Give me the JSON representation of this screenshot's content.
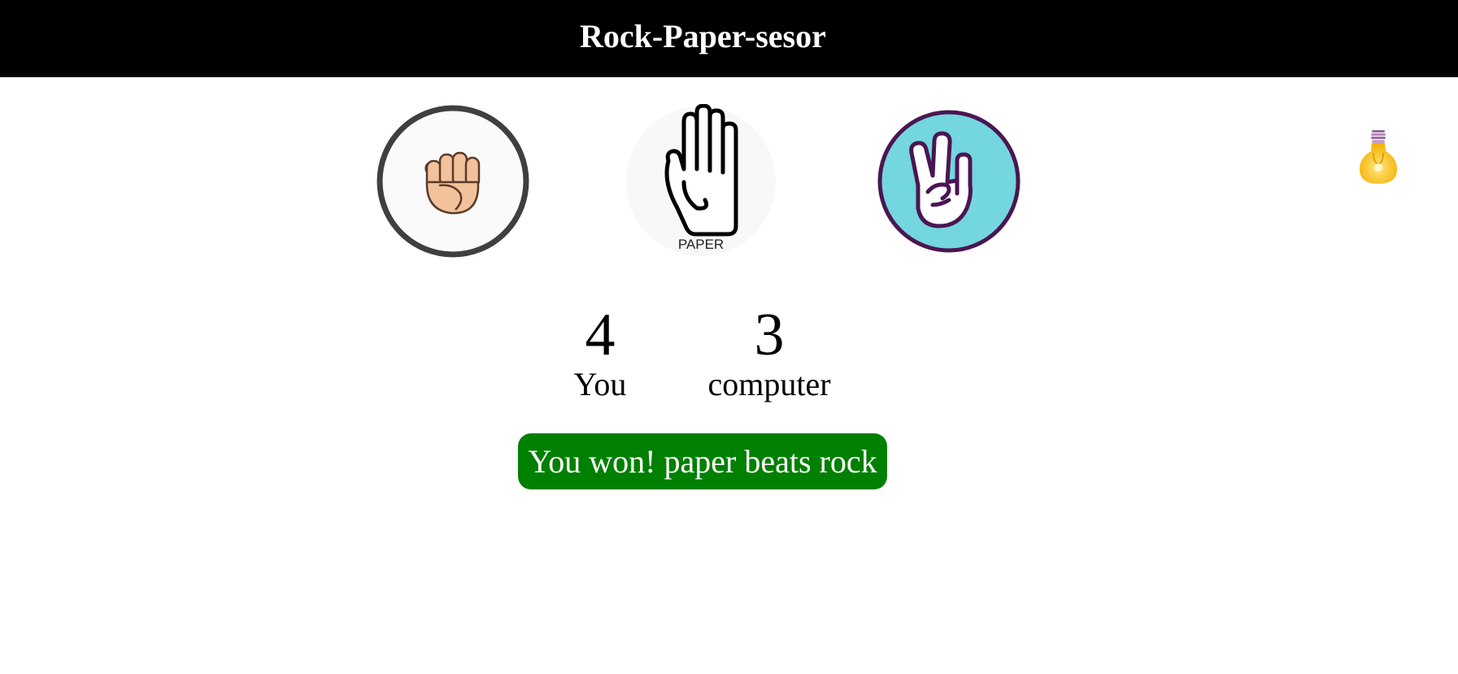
{
  "header": {
    "title": "Rock-Paper-sesor"
  },
  "choices": [
    {
      "id": "rock",
      "caption": ""
    },
    {
      "id": "paper",
      "caption": "PAPER"
    },
    {
      "id": "scissors",
      "caption": ""
    }
  ],
  "icons": {
    "rock": "fist-icon",
    "paper": "open-hand-icon",
    "scissors": "peace-hand-icon",
    "theme": "lightbulb-icon"
  },
  "scores": {
    "user": {
      "value": "4",
      "label": "You"
    },
    "computer": {
      "value": "3",
      "label": "computer"
    }
  },
  "result": {
    "message": "You won! paper beats rock"
  },
  "colors": {
    "header_bg": "#000000",
    "result_bg": "#008000",
    "rock_ring": "#3f3f3f",
    "scissors_fill": "#74d6de",
    "scissors_ring": "#4a1652",
    "skin": "#f2c29c"
  }
}
